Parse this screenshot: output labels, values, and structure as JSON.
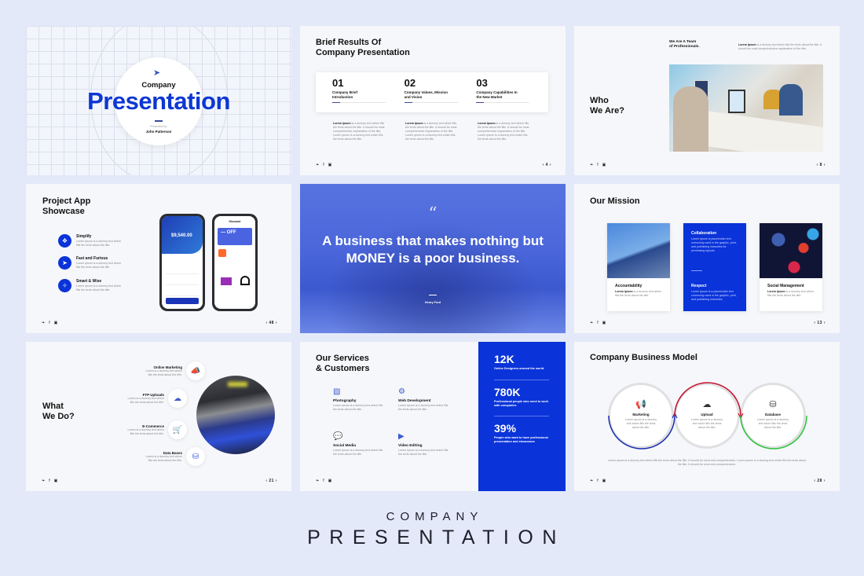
{
  "colors": {
    "accent": "#0a33d9",
    "background": "#e3e9f9",
    "slide_bg": "#f6f7fa",
    "red_arc": "#c8102e",
    "green_arc": "#2bc43b",
    "blue_arc": "#1a2fb0"
  },
  "social_icons": [
    "twitter-icon",
    "facebook-icon",
    "instagram-icon"
  ],
  "social_glyphs": {
    "twitter": "❧",
    "facebook": "f",
    "instagram": "▣"
  },
  "slides": {
    "cover": {
      "icon": "rocket-icon",
      "small_title": "Company",
      "big_title": "Presentation",
      "presented_by_label": "Presented by:",
      "presenter": "John Patterson"
    },
    "brief_results": {
      "title_line1": "Brief Results Of",
      "title_line2": "Company Presentation",
      "items": [
        {
          "number": "01",
          "label_line1": "Company Brief",
          "label_line2": "Introduction",
          "desc_bold": "Lorem Ipsum",
          "desc": " is a dummy text which fills the texts about the title. It should be most comprehensive explanation of the title. Lorem Ipsum is a dummy text which fills the texts about the title."
        },
        {
          "number": "02",
          "label_line1": "Company Values, Mission",
          "label_line2": "and Vision",
          "desc_bold": "Lorem Ipsum",
          "desc": " is a dummy text which fills the texts about the title. It should be most comprehensive explanation of the title. Lorem Ipsum is a dummy text which fills the texts about the title."
        },
        {
          "number": "03",
          "label_line1": "Company Capabilities In",
          "label_line2": "the New Market",
          "desc_bold": "Lorem Ipsum",
          "desc": " is a dummy text which fills the texts about the title. It should be most comprehensive explanation of the title. Lorem Ipsum is a dummy text which fills the texts about the title."
        }
      ],
      "page": "‹ 4 ›"
    },
    "who_we_are": {
      "title_line1": "Who",
      "title_line2": "We Are?",
      "team_line1": "We Are A Team",
      "team_line2": "of Professionals.",
      "lead_bold": "Lorem Ipsum",
      "lead": " is a dummy text which fills the texts about the title. It should be most comprehensive explanation of the title.",
      "image": "office-team-photo",
      "page": "‹ 8 ›"
    },
    "app_showcase": {
      "title_line1": "Project App",
      "title_line2": "Showcase",
      "features": [
        {
          "icon": "tag-icon",
          "glyph": "❖",
          "title": "Simplify",
          "desc": "Lorem ipsum is a dummy text which fills the texts about the title."
        },
        {
          "icon": "rocket-icon",
          "glyph": "➤",
          "title": "Fast and Furious",
          "desc": "Lorem ipsum is a dummy text which fills the texts about the title."
        },
        {
          "icon": "magic-wand-icon",
          "glyph": "✧",
          "title": "Smart & Wise",
          "desc": "Lorem ipsum is a dummy text which fills the texts about the title."
        }
      ],
      "phone1_amount": "$9,540.00",
      "phone2_title": "Discount",
      "phone2_banner": "— OFF",
      "page": "‹ 48 ›"
    },
    "quote": {
      "quote_mark": "“",
      "text": "A business that makes nothing but MONEY is a poor business.",
      "author": "Henry Ford"
    },
    "mission": {
      "title": "Our Mission",
      "cards": [
        {
          "title": "Accountability",
          "desc_bold": "Lorem Ipsum",
          "desc": " is a dummy text which fills the texts about the title.",
          "image": "building-photo"
        },
        {
          "title": "Collaboration",
          "desc": "Lorem ipsum is placeholder text commonly used in the graphic, print, and publishing industries for previewing layouts.",
          "title2": "Respect",
          "desc2": "Lorem ipsum is a placeholder text commonly used in the graphic, print, and publishing industries."
        },
        {
          "title": "Social Management",
          "desc_bold": "Lorem Ipsum",
          "desc": " is a dummy text which fills the texts about the title.",
          "image": "social-apps-photo"
        }
      ],
      "page": "‹ 13 ›"
    },
    "what_we_do": {
      "title_line1": "What",
      "title_line2": "We Do?",
      "services": [
        {
          "icon": "megaphone-icon",
          "glyph": "📣",
          "title": "Online Marketing",
          "desc": "Lorem is a dummy text which fills the texts about the title."
        },
        {
          "icon": "cloud-upload-icon",
          "glyph": "☁",
          "title": "FTP Uploads",
          "desc": "Lorem is a dummy text which fills the texts about the title."
        },
        {
          "icon": "shopping-cart-icon",
          "glyph": "🛒",
          "title": "E-Commerce",
          "desc": "Lorem is a dummy text which fills the texts about the title."
        },
        {
          "icon": "database-icon",
          "glyph": "⛁",
          "title": "Data Bases",
          "desc": "Lorem is a dummy text which fills the texts about the title."
        }
      ],
      "image": "network-cables-photo",
      "page": "‹ 21 ›"
    },
    "services_customers": {
      "title_line1": "Our Services",
      "title_line2": "& Customers",
      "services": [
        {
          "icon": "image-icon",
          "glyph": "▨",
          "title": "Photography",
          "desc": "Lorem ipsum is a dummy text which fills the texts about the title."
        },
        {
          "icon": "gear-icon",
          "glyph": "⚙",
          "title": "Web Development",
          "desc": "Lorem ipsum is a dummy text which fills the texts about the title."
        },
        {
          "icon": "chat-bubbles-icon",
          "glyph": "💬",
          "title": "Social Media",
          "desc": "Lorem ipsum is a dummy text which fills the texts about the title."
        },
        {
          "icon": "video-icon",
          "glyph": "▶",
          "title": "Video Editing",
          "desc": "Lorem ipsum is a dummy text which fills the texts about the title."
        }
      ],
      "stats": [
        {
          "value": "12K",
          "desc": "Online Designers around the world."
        },
        {
          "value": "780K",
          "desc": "Professional people who need to work with companies"
        },
        {
          "value": "39%",
          "desc": "People who want to have professional presentation and showcases"
        }
      ]
    },
    "business_model": {
      "title": "Company Business Model",
      "steps": [
        {
          "icon": "megaphone-icon",
          "glyph": "📢",
          "title": "Marketing",
          "desc": "Lorem ipsum is a dummy text which fills the texts about the title."
        },
        {
          "icon": "cloud-upload-icon",
          "glyph": "☁",
          "title": "Upload",
          "desc": "Lorem ipsum is a dummy text which fills the texts about the title."
        },
        {
          "icon": "database-icon",
          "glyph": "⛁",
          "title": "Database",
          "desc": "Lorem ipsum is a dummy text which fills the texts about the title."
        }
      ],
      "footer": "Lorem ipsum is a dummy text which fills the texts about the title. It should be short and comprehensive. Lorem ipsum is a dummy text which fills the texts about the title. It should be short and comprehensive.",
      "page": "‹ 28 ›"
    }
  },
  "branding": {
    "line1": "COMPANY",
    "line2": "PRESENTATION"
  }
}
